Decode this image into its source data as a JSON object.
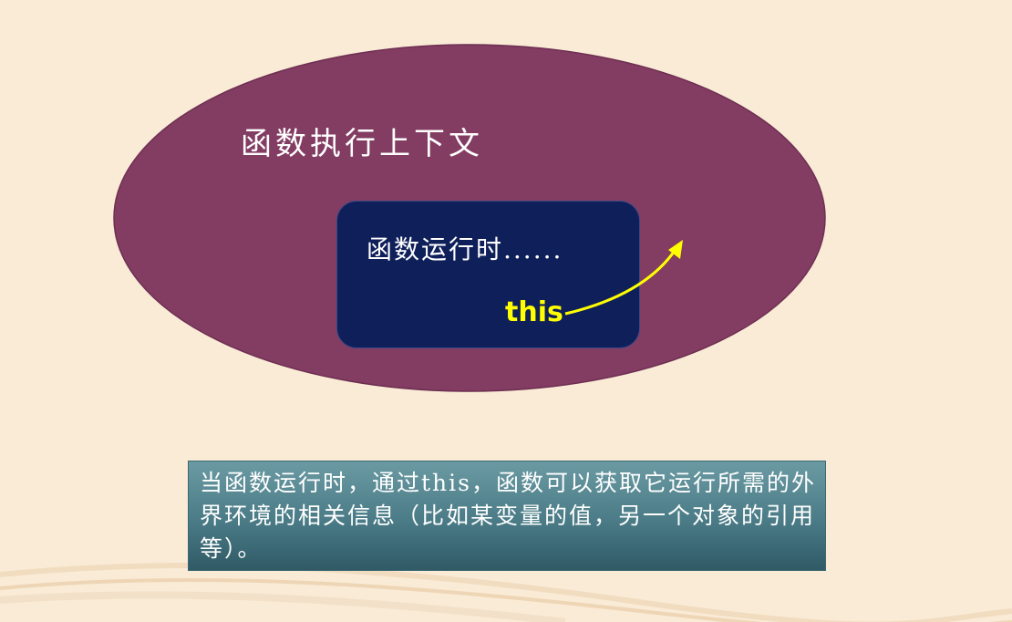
{
  "diagram": {
    "context_title": "函数执行上下文",
    "inner_text": "函数运行时......",
    "this_label": "this",
    "note": "当函数运行时，通过this，函数可以获取它运行所需的外界环境的相关信息（比如某变量的值，另一个对象的引用等）。"
  },
  "colors": {
    "background": "#f9ebd6",
    "ellipse_fill": "#833c62",
    "inner_box_fill": "#0f1f5a",
    "this_color": "#ffff00",
    "note_box": "#4a7b86"
  }
}
